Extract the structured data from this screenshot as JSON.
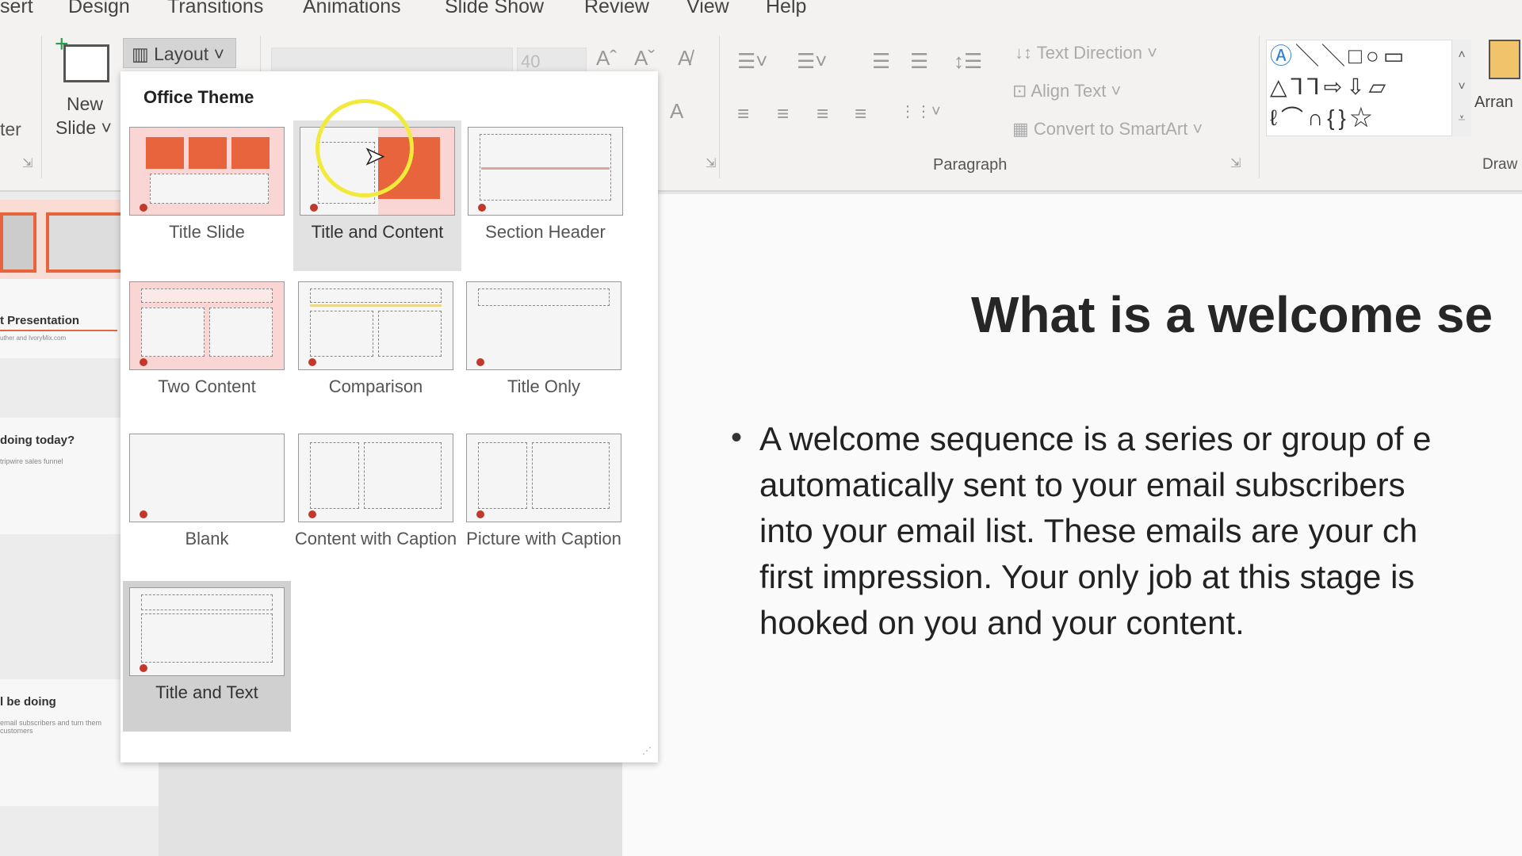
{
  "menu_tabs": [
    "sert",
    "Design",
    "Transitions",
    "Animations",
    "Slide Show",
    "Review",
    "View",
    "Help"
  ],
  "ribbon": {
    "new_slide": [
      "New",
      "Slide"
    ],
    "layout": "Layout",
    "cut_label": "ter",
    "font_size": "40",
    "text_direction": "Text Direction",
    "align_text": "Align Text",
    "convert_smartart": "Convert to SmartArt",
    "paragraph_label": "Paragraph",
    "drawing_label": "Draw",
    "arrange_label": "Arran"
  },
  "layout_panel": {
    "theme": "Office Theme",
    "layouts": [
      {
        "label": "Title Slide"
      },
      {
        "label": "Title and Content",
        "state": "hover"
      },
      {
        "label": "Section Header"
      },
      {
        "label": "Two Content"
      },
      {
        "label": "Comparison"
      },
      {
        "label": "Title Only"
      },
      {
        "label": "Blank"
      },
      {
        "label": "Content with Caption"
      },
      {
        "label": "Picture with Caption"
      },
      {
        "label": "Title and Text",
        "state": "selected"
      }
    ]
  },
  "slides_panel": [
    {
      "title": "t Presentation",
      "sub": "uther and IvoryMix.com"
    },
    {
      "title": "doing today?",
      "sub": "tripwire sales funnel"
    },
    {
      "title": "l be doing",
      "sub": "email subscribers and turn them customers"
    }
  ],
  "slide": {
    "title": "What is a welcome se",
    "bullet_lines": [
      "A welcome sequence is a series or group of e",
      "automatically sent to your email subscribers",
      "into your email list. These emails are your ch",
      "first impression. Your only job at this stage is",
      "hooked on you and your content."
    ]
  },
  "colors": {
    "accent": "#e8643c",
    "highlight": "#f2ea3a"
  }
}
